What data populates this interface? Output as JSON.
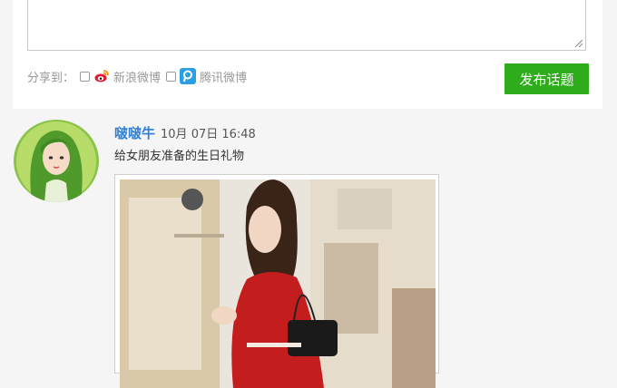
{
  "composer": {
    "textarea_value": "",
    "share_label": "分享到：",
    "services": [
      {
        "name": "sina-weibo",
        "label": "新浪微博",
        "icon": "sina-weibo-icon",
        "checked": false,
        "color": "#e6162d"
      },
      {
        "name": "tencent-weibo",
        "label": "腾讯微博",
        "icon": "tencent-weibo-icon",
        "checked": false,
        "color": "#2b9fe3"
      }
    ],
    "publish_label": "发布话题",
    "publish_color": "#2fac1c"
  },
  "post": {
    "username": "啵啵牛",
    "timestamp": "10月 07日 16:48",
    "content": "给女朋友准备的生日礼物",
    "username_color": "#2f7fd6"
  }
}
